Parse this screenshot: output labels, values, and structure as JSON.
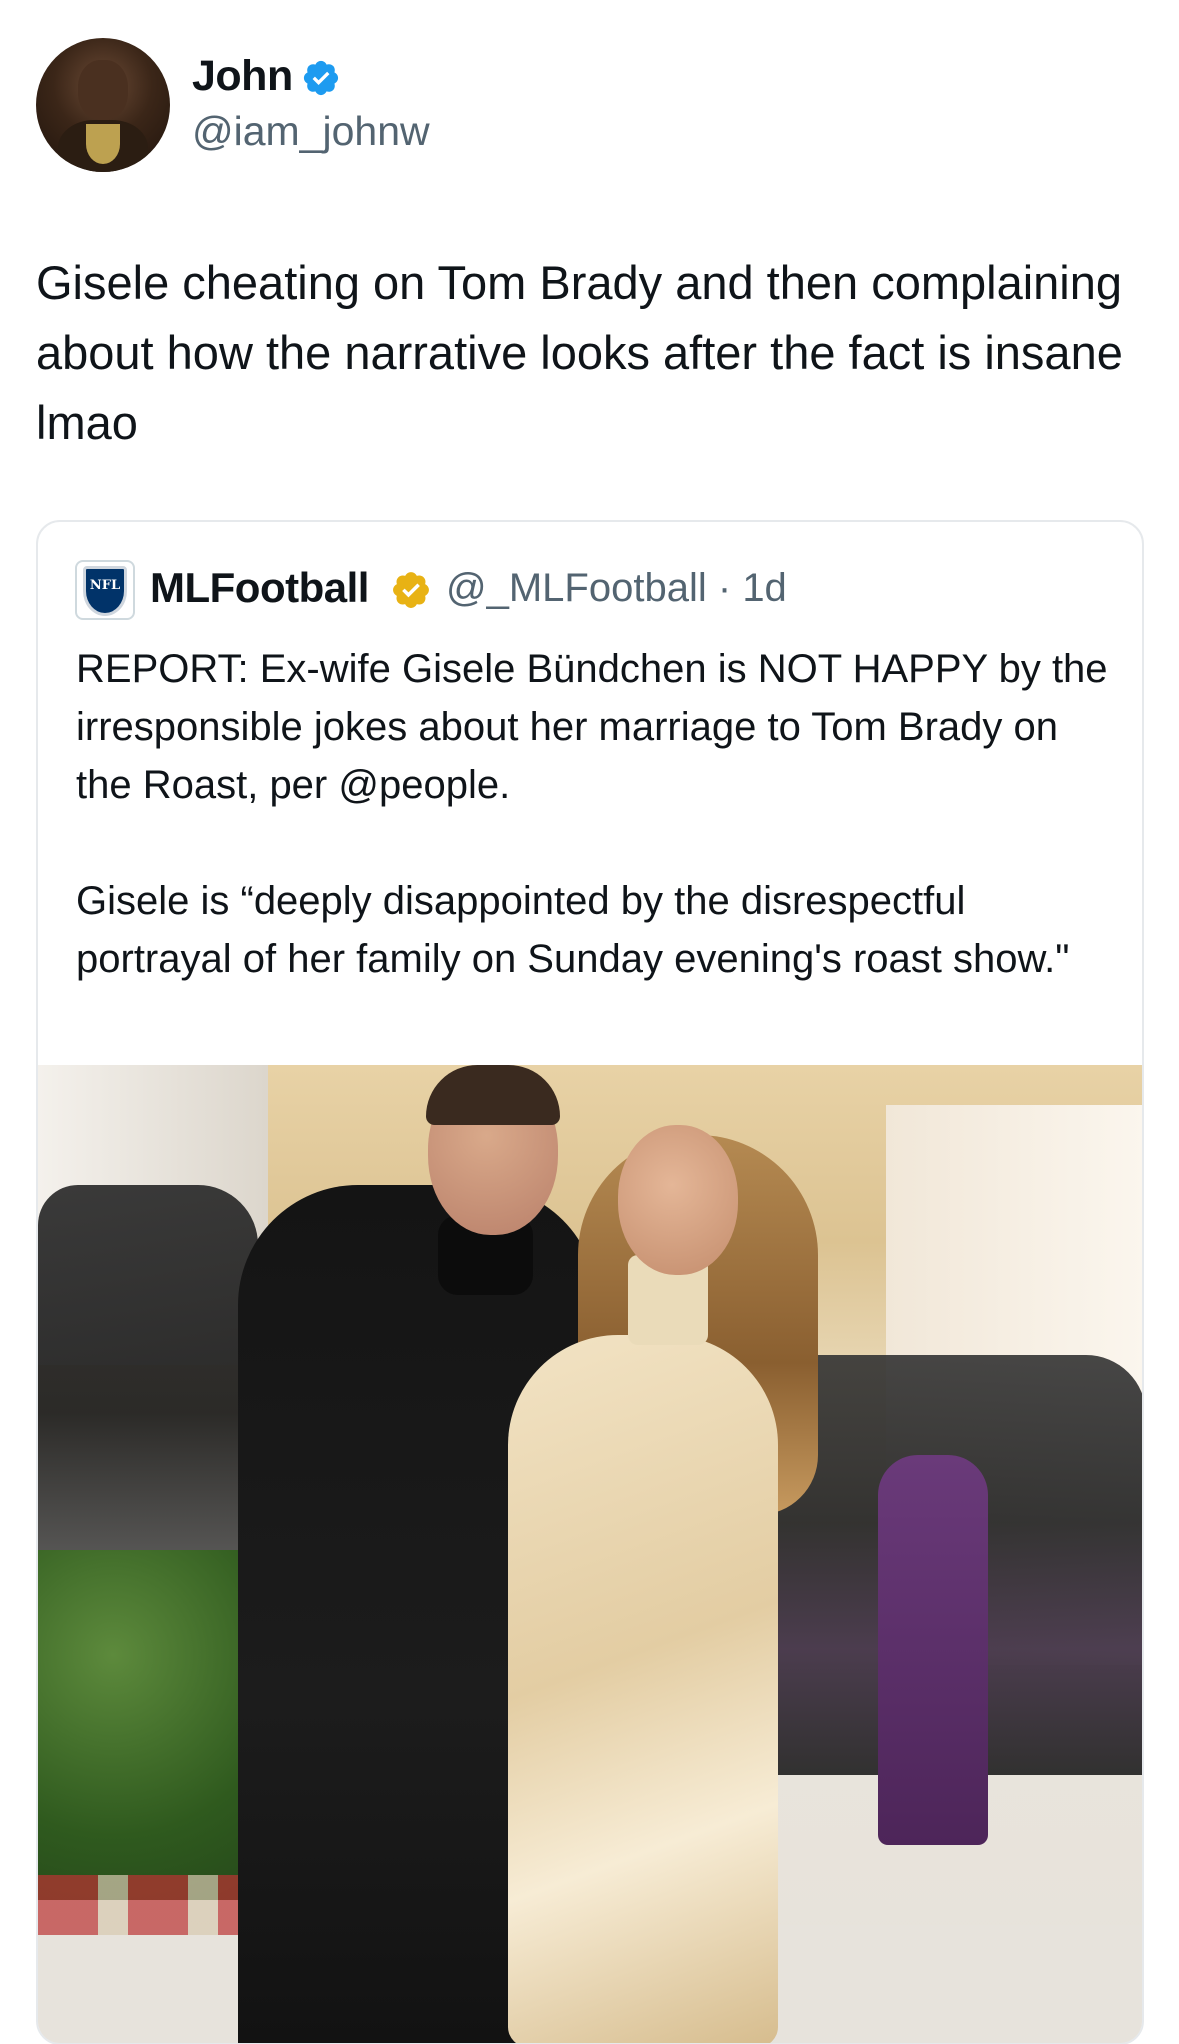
{
  "tweet": {
    "author": {
      "name": "John",
      "handle": "@iam_johnw",
      "verified_badge": "blue-check-icon",
      "badge_color": "#1d9bf0"
    },
    "text": "Gisele cheating on Tom Brady and then complaining about how the narrative looks after the fact is insane lmao"
  },
  "quoted_tweet": {
    "author": {
      "logo": "nfl-shield-icon",
      "logo_text": "NFL",
      "name": "MLFootball",
      "handle": "@_MLFootball",
      "separator": "·",
      "time": "1d",
      "verified_badge": "gold-check-icon",
      "badge_color": "#e8b214"
    },
    "text": "REPORT: Ex-wife Gisele Bündchen is NOT HAPPY by the irresponsible jokes about her marriage to Tom Brady on the Roast, per @people.\n\nGisele is “deeply disappointed by the disrespectful portrayal of her family on Sunday evening's roast show.\"",
    "media": "red-carpet-photo"
  },
  "colors": {
    "text_primary": "#0f1419",
    "text_secondary": "#536471",
    "border": "#e6e9ec"
  }
}
